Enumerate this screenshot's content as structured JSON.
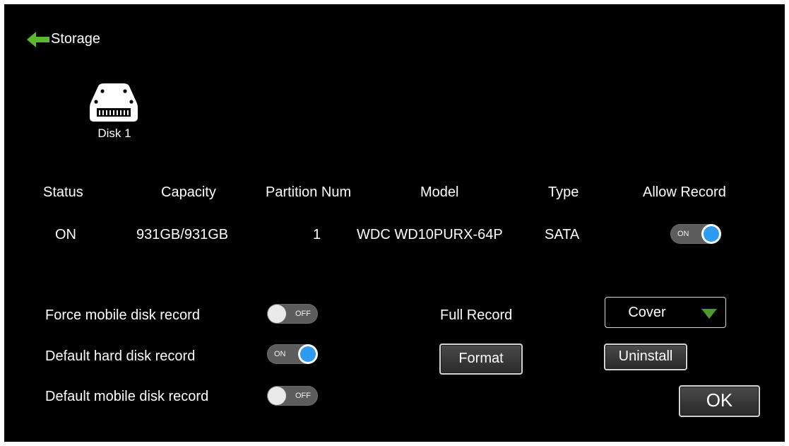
{
  "header": {
    "title": "Storage",
    "back_icon": "arrow-left-icon",
    "accent": "#5cb82e"
  },
  "disk": {
    "label": "Disk 1",
    "icon": "hard-disk-icon"
  },
  "table": {
    "headers": [
      "Status",
      "Capacity",
      "Partition Num",
      "Model",
      "Type",
      "Allow Record"
    ],
    "row": {
      "status": "ON",
      "capacity": "931GB/931GB",
      "partition_num": "1",
      "model": "WDC WD10PURX-64P",
      "type": "SATA",
      "allow_record": {
        "state": "on",
        "label": "ON"
      }
    }
  },
  "options": {
    "force_mobile": {
      "label": "Force mobile disk record",
      "state": "off",
      "toggle_label": "OFF"
    },
    "default_hard": {
      "label": "Default hard disk record",
      "state": "on",
      "toggle_label": "ON"
    },
    "default_mobile": {
      "label": "Default mobile disk record",
      "state": "off",
      "toggle_label": "OFF"
    }
  },
  "full_record": {
    "label": "Full Record",
    "value": "Cover"
  },
  "buttons": {
    "format": "Format",
    "uninstall": "Uninstall",
    "ok": "OK"
  },
  "colors": {
    "toggle_on_knob": "#2e9af0",
    "dropdown_arrow": "#4f9a2c"
  }
}
